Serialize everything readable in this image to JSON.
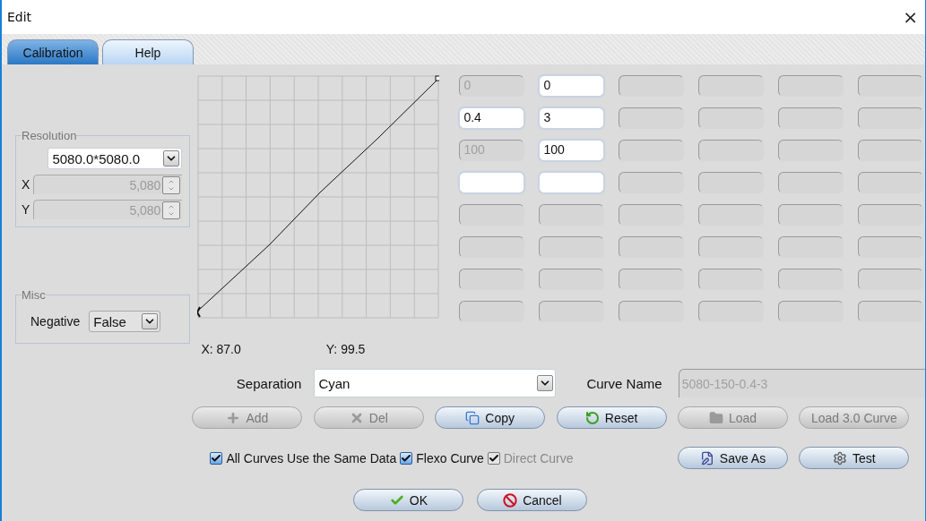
{
  "window": {
    "title": "Edit",
    "close": "×"
  },
  "tabs": [
    {
      "label": "Calibration",
      "selected": true
    },
    {
      "label": "Help",
      "selected": false
    }
  ],
  "resolution": {
    "title": "Resolution",
    "preset": "5080.0*5080.0",
    "x_label": "X",
    "x_value": "5,080",
    "y_label": "Y",
    "y_value": "5,080",
    "disabled": true
  },
  "misc": {
    "title": "Misc",
    "negative_label": "Negative",
    "negative_value": "False"
  },
  "points": [
    [
      {
        "value": "0",
        "disabled": true
      },
      {
        "value": "0",
        "disabled": false
      },
      {
        "disabled": true
      },
      {
        "disabled": true
      },
      {
        "disabled": true
      },
      {
        "disabled": true
      }
    ],
    [
      {
        "value": "0.4",
        "disabled": false
      },
      {
        "value": "3",
        "disabled": false
      },
      {
        "disabled": true
      },
      {
        "disabled": true
      },
      {
        "disabled": true
      },
      {
        "disabled": true
      }
    ],
    [
      {
        "value": "100",
        "disabled": true
      },
      {
        "value": "100",
        "disabled": false
      },
      {
        "disabled": true
      },
      {
        "disabled": true
      },
      {
        "disabled": true
      },
      {
        "disabled": true
      }
    ],
    [
      {
        "disabled": false
      },
      {
        "disabled": false
      },
      {
        "disabled": true
      },
      {
        "disabled": true
      },
      {
        "disabled": true
      },
      {
        "disabled": true
      }
    ],
    [
      {
        "disabled": true
      },
      {
        "disabled": true
      },
      {
        "disabled": true
      },
      {
        "disabled": true
      },
      {
        "disabled": true
      },
      {
        "disabled": true
      }
    ],
    [
      {
        "disabled": true
      },
      {
        "disabled": true
      },
      {
        "disabled": true
      },
      {
        "disabled": true
      },
      {
        "disabled": true
      },
      {
        "disabled": true
      }
    ],
    [
      {
        "disabled": true
      },
      {
        "disabled": true
      },
      {
        "disabled": true
      },
      {
        "disabled": true
      },
      {
        "disabled": true
      },
      {
        "disabled": true
      }
    ],
    [
      {
        "disabled": true
      },
      {
        "disabled": true
      },
      {
        "disabled": true
      },
      {
        "disabled": true
      },
      {
        "disabled": true
      },
      {
        "disabled": true
      }
    ]
  ],
  "readout": {
    "x": "X: 87.0",
    "y": "Y: 99.5"
  },
  "separation": {
    "label": "Separation",
    "value": "Cyan"
  },
  "curve_name": {
    "label": "Curve Name",
    "value": "5080-150-0.4-3",
    "disabled": true
  },
  "actions": [
    {
      "kind": "add",
      "label": "Add",
      "disabled": true
    },
    {
      "kind": "del",
      "label": "Del",
      "disabled": true
    },
    {
      "kind": "copy",
      "label": "Copy",
      "disabled": false
    },
    {
      "kind": "reset",
      "label": "Reset",
      "disabled": false
    },
    {
      "kind": "load",
      "label": "Load",
      "disabled": true
    },
    {
      "kind": "plain",
      "label": "Load 3.0 Curve",
      "disabled": true
    }
  ],
  "options": [
    {
      "label": "All Curves Use the Same Data",
      "checked": true,
      "disabled": false
    },
    {
      "label": "Flexo Curve",
      "checked": true,
      "disabled": false
    },
    {
      "label": "Direct Curve",
      "checked": true,
      "disabled": true
    }
  ],
  "side_actions": [
    {
      "kind": "save",
      "label": "Save As",
      "disabled": false
    },
    {
      "kind": "test",
      "label": "Test",
      "disabled": false
    }
  ],
  "footer": [
    {
      "kind": "ok",
      "label": "OK",
      "disabled": false
    },
    {
      "kind": "cancel",
      "label": "Cancel",
      "disabled": false
    }
  ]
}
